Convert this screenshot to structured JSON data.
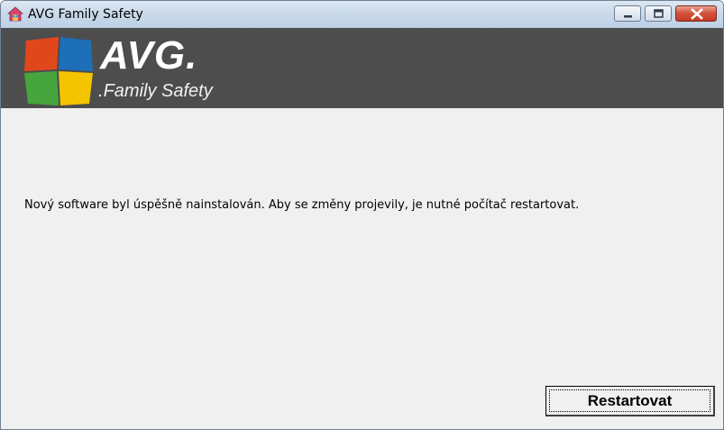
{
  "window": {
    "title": "AVG Family Safety",
    "controls": {
      "minimize_icon": "minimize-icon",
      "maximize_icon": "maximize-icon",
      "close_icon": "close-icon"
    }
  },
  "banner": {
    "logo_text": "AVG",
    "logo_dot": ".",
    "product_name": "Family Safety",
    "background_color": "#4d4d4d"
  },
  "content": {
    "message": "Nový software byl úspěšně nainstalován. Aby se změny projevily, je nutné počítač restartovat.",
    "restart_button_label": "Restartovat"
  }
}
